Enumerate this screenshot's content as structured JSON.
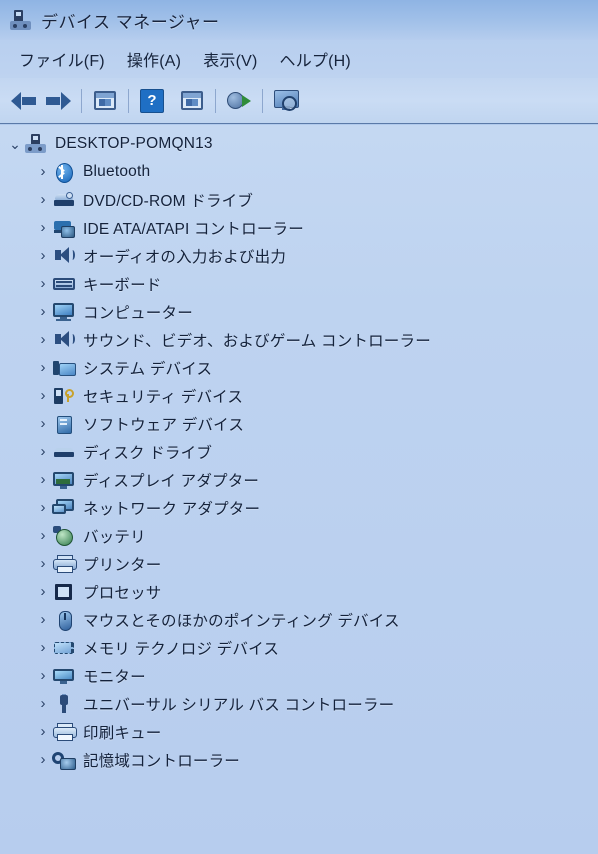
{
  "window": {
    "title": "デバイス マネージャー",
    "title_icon": "device-manager-icon"
  },
  "menubar": {
    "items": [
      {
        "label": "ファイル(F)",
        "name": "menu-file"
      },
      {
        "label": "操作(A)",
        "name": "menu-action"
      },
      {
        "label": "表示(V)",
        "name": "menu-view"
      },
      {
        "label": "ヘルプ(H)",
        "name": "menu-help"
      }
    ]
  },
  "toolbar": {
    "buttons": [
      {
        "icon": "back-arrow-icon",
        "name": "toolbar-back"
      },
      {
        "icon": "forward-arrow-icon",
        "name": "toolbar-forward"
      },
      {
        "icon": "properties-icon",
        "name": "toolbar-properties"
      },
      {
        "icon": "help-icon",
        "name": "toolbar-help"
      },
      {
        "icon": "show-hidden-devices-icon",
        "name": "toolbar-show-hidden"
      },
      {
        "icon": "scan-hardware-changes-icon",
        "name": "toolbar-scan-hardware"
      },
      {
        "icon": "update-driver-monitor-icon",
        "name": "toolbar-update-driver"
      }
    ]
  },
  "tree": {
    "root": {
      "label": "DESKTOP-POMQN13",
      "expander": "⌄",
      "icon": "computer-icon"
    },
    "expander_collapsed": "›",
    "items": [
      {
        "label": "Bluetooth",
        "icon": "bluetooth-icon"
      },
      {
        "label": "DVD/CD-ROM ドライブ",
        "icon": "dvd-drive-icon"
      },
      {
        "label": "IDE ATA/ATAPI コントローラー",
        "icon": "ide-controller-icon"
      },
      {
        "label": "オーディオの入力および出力",
        "icon": "audio-io-icon"
      },
      {
        "label": "キーボード",
        "icon": "keyboard-icon"
      },
      {
        "label": "コンピューター",
        "icon": "computer-device-icon"
      },
      {
        "label": "サウンド、ビデオ、およびゲーム コントローラー",
        "icon": "sound-video-game-icon"
      },
      {
        "label": "システム デバイス",
        "icon": "system-device-icon"
      },
      {
        "label": "セキュリティ デバイス",
        "icon": "security-device-icon"
      },
      {
        "label": "ソフトウェア デバイス",
        "icon": "software-device-icon"
      },
      {
        "label": "ディスク ドライブ",
        "icon": "disk-drive-icon"
      },
      {
        "label": "ディスプレイ アダプター",
        "icon": "display-adapter-icon"
      },
      {
        "label": "ネットワーク アダプター",
        "icon": "network-adapter-icon"
      },
      {
        "label": "バッテリ",
        "icon": "battery-icon"
      },
      {
        "label": "プリンター",
        "icon": "printer-icon"
      },
      {
        "label": "プロセッサ",
        "icon": "processor-icon"
      },
      {
        "label": "マウスとそのほかのポインティング デバイス",
        "icon": "mouse-icon"
      },
      {
        "label": "メモリ テクノロジ デバイス",
        "icon": "memory-technology-icon"
      },
      {
        "label": "モニター",
        "icon": "monitor-icon"
      },
      {
        "label": "ユニバーサル シリアル バス コントローラー",
        "icon": "usb-controller-icon"
      },
      {
        "label": "印刷キュー",
        "icon": "print-queue-icon"
      },
      {
        "label": "記憶域コントローラー",
        "icon": "storage-controller-icon"
      }
    ]
  },
  "colors": {
    "titlebar": "#9abde7",
    "menubar": "#bad1ef",
    "toolbar": "#c6d9f2",
    "tree_bg": "#bed3f0",
    "text": "#14223b",
    "accent_blue": "#1f6fc4"
  }
}
